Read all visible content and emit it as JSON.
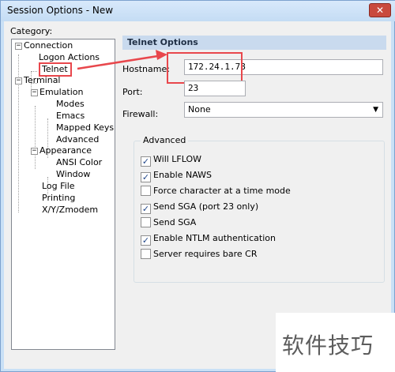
{
  "window": {
    "title": "Session Options - New",
    "close_label": "✕"
  },
  "category": {
    "label": "Category:"
  },
  "tree": {
    "connection": "Connection",
    "logon_actions": "Logon Actions",
    "telnet": "Telnet",
    "terminal": "Terminal",
    "emulation": "Emulation",
    "modes": "Modes",
    "emacs": "Emacs",
    "mapped_keys": "Mapped Keys",
    "advanced": "Advanced",
    "appearance": "Appearance",
    "ansi_color": "ANSI Color",
    "window": "Window",
    "log_file": "Log File",
    "printing": "Printing",
    "xyz_modem": "X/Y/Zmodem",
    "collapse_symbol": "−"
  },
  "panel": {
    "header": "Telnet Options",
    "hostname_label": "Hostname:",
    "hostname_value": "172.24.1.78",
    "port_label": "Port:",
    "port_value": "23",
    "firewall_label": "Firewall:",
    "firewall_value": "None",
    "dropdown_arrow": "▼"
  },
  "advanced_group": {
    "title": "Advanced",
    "check_mark": "✓",
    "options": [
      {
        "label": "Will LFLOW",
        "checked": true
      },
      {
        "label": "Enable NAWS",
        "checked": true
      },
      {
        "label": "Force character at a time mode",
        "checked": false
      },
      {
        "label": "Send SGA (port 23 only)",
        "checked": true
      },
      {
        "label": "Send SGA",
        "checked": false
      },
      {
        "label": "Enable NTLM authentication",
        "checked": true
      },
      {
        "label": "Server requires bare CR",
        "checked": false
      }
    ]
  },
  "watermark": {
    "text": "软件技巧"
  },
  "colors": {
    "annotation_red": "#e8474c",
    "panel_header_bg": "#c9daee",
    "title_bar": "#c4dcf4"
  }
}
